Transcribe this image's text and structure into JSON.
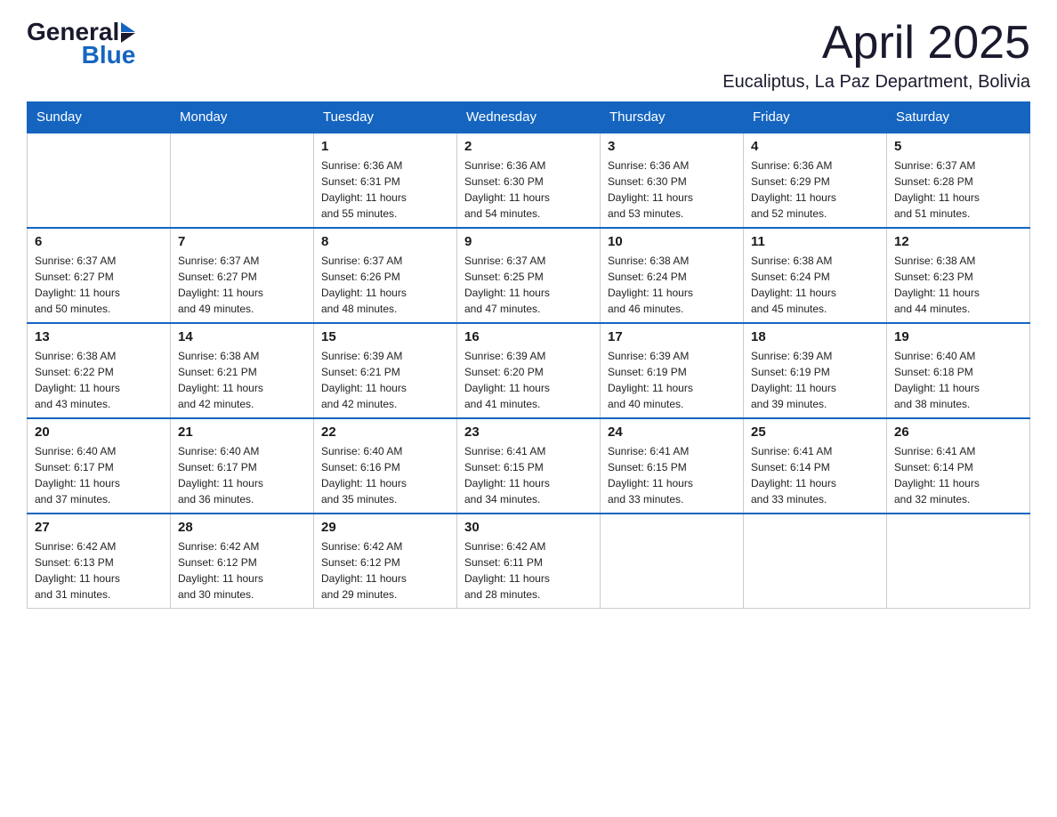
{
  "header": {
    "logo": {
      "general": "General",
      "blue": "Blue"
    },
    "title": "April 2025",
    "location": "Eucaliptus, La Paz Department, Bolivia"
  },
  "calendar": {
    "days_of_week": [
      "Sunday",
      "Monday",
      "Tuesday",
      "Wednesday",
      "Thursday",
      "Friday",
      "Saturday"
    ],
    "weeks": [
      [
        {
          "day": "",
          "info": ""
        },
        {
          "day": "",
          "info": ""
        },
        {
          "day": "1",
          "info": "Sunrise: 6:36 AM\nSunset: 6:31 PM\nDaylight: 11 hours\nand 55 minutes."
        },
        {
          "day": "2",
          "info": "Sunrise: 6:36 AM\nSunset: 6:30 PM\nDaylight: 11 hours\nand 54 minutes."
        },
        {
          "day": "3",
          "info": "Sunrise: 6:36 AM\nSunset: 6:30 PM\nDaylight: 11 hours\nand 53 minutes."
        },
        {
          "day": "4",
          "info": "Sunrise: 6:36 AM\nSunset: 6:29 PM\nDaylight: 11 hours\nand 52 minutes."
        },
        {
          "day": "5",
          "info": "Sunrise: 6:37 AM\nSunset: 6:28 PM\nDaylight: 11 hours\nand 51 minutes."
        }
      ],
      [
        {
          "day": "6",
          "info": "Sunrise: 6:37 AM\nSunset: 6:27 PM\nDaylight: 11 hours\nand 50 minutes."
        },
        {
          "day": "7",
          "info": "Sunrise: 6:37 AM\nSunset: 6:27 PM\nDaylight: 11 hours\nand 49 minutes."
        },
        {
          "day": "8",
          "info": "Sunrise: 6:37 AM\nSunset: 6:26 PM\nDaylight: 11 hours\nand 48 minutes."
        },
        {
          "day": "9",
          "info": "Sunrise: 6:37 AM\nSunset: 6:25 PM\nDaylight: 11 hours\nand 47 minutes."
        },
        {
          "day": "10",
          "info": "Sunrise: 6:38 AM\nSunset: 6:24 PM\nDaylight: 11 hours\nand 46 minutes."
        },
        {
          "day": "11",
          "info": "Sunrise: 6:38 AM\nSunset: 6:24 PM\nDaylight: 11 hours\nand 45 minutes."
        },
        {
          "day": "12",
          "info": "Sunrise: 6:38 AM\nSunset: 6:23 PM\nDaylight: 11 hours\nand 44 minutes."
        }
      ],
      [
        {
          "day": "13",
          "info": "Sunrise: 6:38 AM\nSunset: 6:22 PM\nDaylight: 11 hours\nand 43 minutes."
        },
        {
          "day": "14",
          "info": "Sunrise: 6:38 AM\nSunset: 6:21 PM\nDaylight: 11 hours\nand 42 minutes."
        },
        {
          "day": "15",
          "info": "Sunrise: 6:39 AM\nSunset: 6:21 PM\nDaylight: 11 hours\nand 42 minutes."
        },
        {
          "day": "16",
          "info": "Sunrise: 6:39 AM\nSunset: 6:20 PM\nDaylight: 11 hours\nand 41 minutes."
        },
        {
          "day": "17",
          "info": "Sunrise: 6:39 AM\nSunset: 6:19 PM\nDaylight: 11 hours\nand 40 minutes."
        },
        {
          "day": "18",
          "info": "Sunrise: 6:39 AM\nSunset: 6:19 PM\nDaylight: 11 hours\nand 39 minutes."
        },
        {
          "day": "19",
          "info": "Sunrise: 6:40 AM\nSunset: 6:18 PM\nDaylight: 11 hours\nand 38 minutes."
        }
      ],
      [
        {
          "day": "20",
          "info": "Sunrise: 6:40 AM\nSunset: 6:17 PM\nDaylight: 11 hours\nand 37 minutes."
        },
        {
          "day": "21",
          "info": "Sunrise: 6:40 AM\nSunset: 6:17 PM\nDaylight: 11 hours\nand 36 minutes."
        },
        {
          "day": "22",
          "info": "Sunrise: 6:40 AM\nSunset: 6:16 PM\nDaylight: 11 hours\nand 35 minutes."
        },
        {
          "day": "23",
          "info": "Sunrise: 6:41 AM\nSunset: 6:15 PM\nDaylight: 11 hours\nand 34 minutes."
        },
        {
          "day": "24",
          "info": "Sunrise: 6:41 AM\nSunset: 6:15 PM\nDaylight: 11 hours\nand 33 minutes."
        },
        {
          "day": "25",
          "info": "Sunrise: 6:41 AM\nSunset: 6:14 PM\nDaylight: 11 hours\nand 33 minutes."
        },
        {
          "day": "26",
          "info": "Sunrise: 6:41 AM\nSunset: 6:14 PM\nDaylight: 11 hours\nand 32 minutes."
        }
      ],
      [
        {
          "day": "27",
          "info": "Sunrise: 6:42 AM\nSunset: 6:13 PM\nDaylight: 11 hours\nand 31 minutes."
        },
        {
          "day": "28",
          "info": "Sunrise: 6:42 AM\nSunset: 6:12 PM\nDaylight: 11 hours\nand 30 minutes."
        },
        {
          "day": "29",
          "info": "Sunrise: 6:42 AM\nSunset: 6:12 PM\nDaylight: 11 hours\nand 29 minutes."
        },
        {
          "day": "30",
          "info": "Sunrise: 6:42 AM\nSunset: 6:11 PM\nDaylight: 11 hours\nand 28 minutes."
        },
        {
          "day": "",
          "info": ""
        },
        {
          "day": "",
          "info": ""
        },
        {
          "day": "",
          "info": ""
        }
      ]
    ]
  }
}
